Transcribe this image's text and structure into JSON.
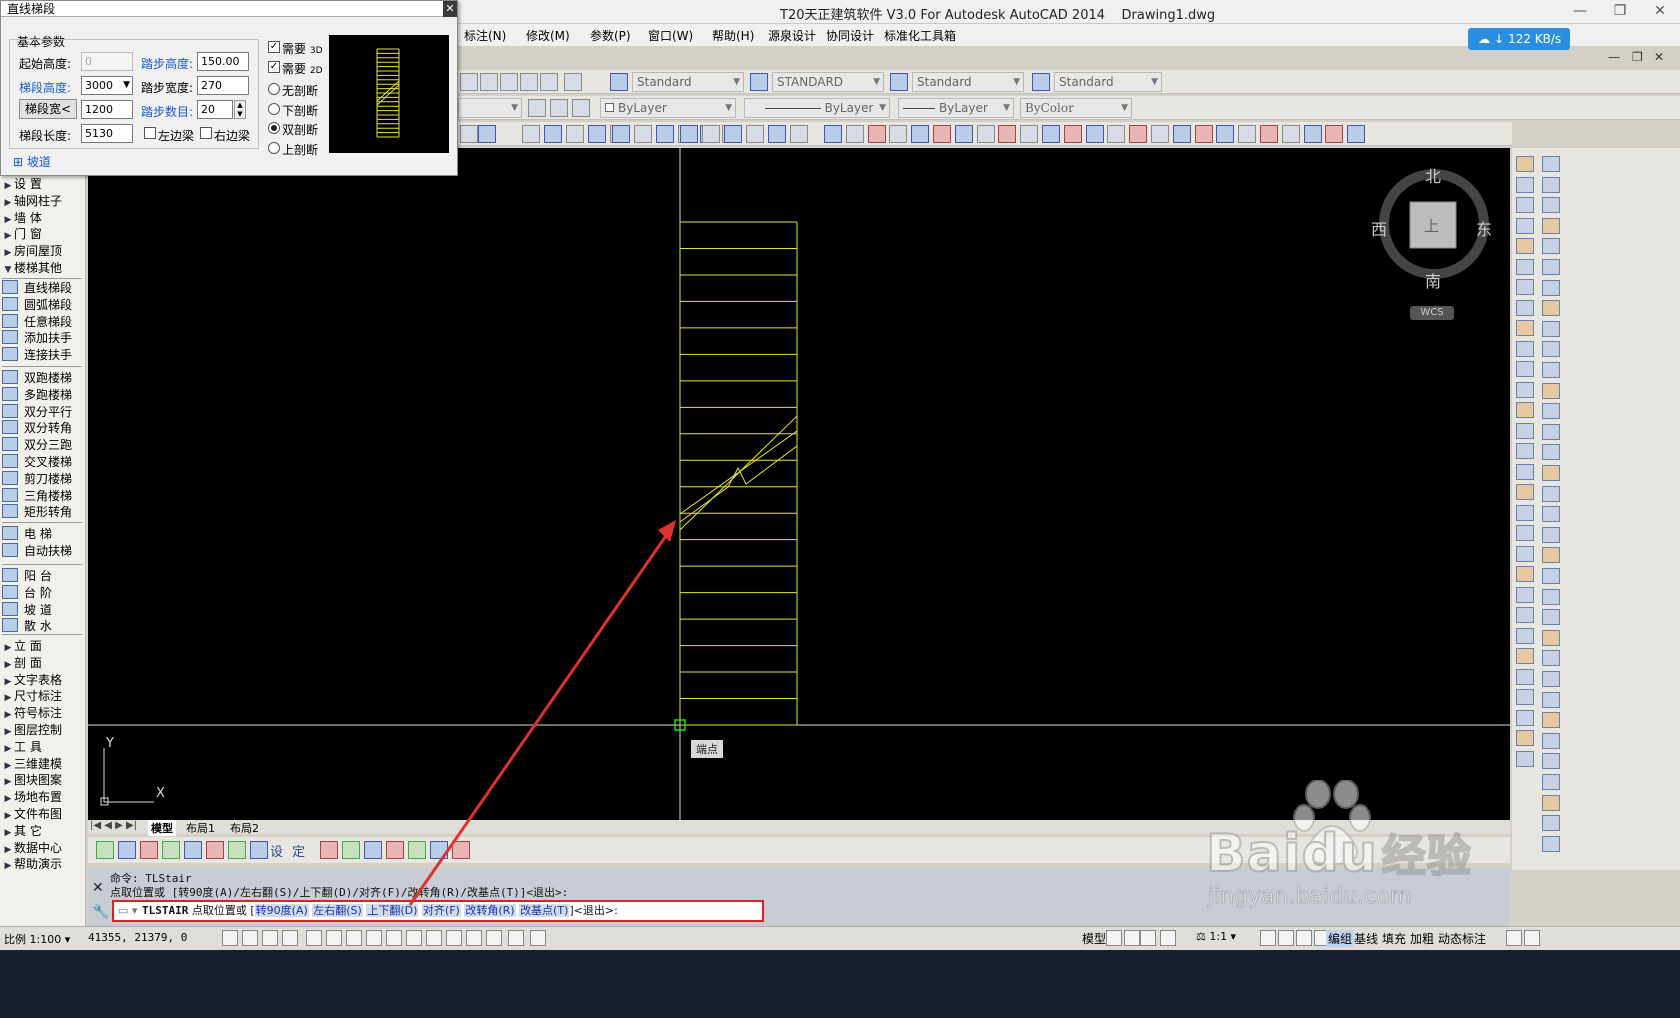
{
  "window": {
    "title": "T20天正建筑软件 V3.0 For Autodesk AutoCAD 2014    Drawing1.dwg",
    "min": "—",
    "restore": "❐",
    "close": "✕"
  },
  "menubar": {
    "items": [
      "标注(N)",
      "修改(M)",
      "参数(P)",
      "窗口(W)",
      "帮助(H)",
      "源泉设计",
      "协同设计",
      "标准化工具箱"
    ]
  },
  "speed_badge": "122 KB/s",
  "mdi_controls": [
    "—",
    "❐",
    "✕"
  ],
  "toolbar": {
    "styles": [
      "Standard",
      "STANDARD",
      "Standard",
      "Standard"
    ],
    "layers": [
      "ByLayer",
      "ByLayer",
      "ByLayer",
      "ByColor"
    ]
  },
  "dialog": {
    "title": "直线梯段",
    "group_title": "基本参数",
    "start_height_label": "起始高度:",
    "start_height_value": "0",
    "step_height_label": "踏步高度:",
    "step_height_value": "150.00",
    "flight_height_label": "梯段高度:",
    "flight_height_value": "3000",
    "step_width_label": "踏步宽度:",
    "step_width_value": "270",
    "flight_width_button": "梯段宽<",
    "flight_width_value": "1200",
    "step_count_label": "踏步数目:",
    "step_count_value": "20",
    "flight_length_label": "梯段长度:",
    "flight_length_value": "5130",
    "left_beam_label": "左边梁",
    "right_beam_label": "右边梁",
    "need3d_label": "需要",
    "need3d_tag": "3D",
    "need2d_label": "需要",
    "need2d_tag": "2D",
    "radio_none": "无剖断",
    "radio_lower": "下剖断",
    "radio_double": "双剖断",
    "radio_upper": "上剖断",
    "ramp_label": "坡道",
    "ramp_prefix": "⊞"
  },
  "left_panel": {
    "group1": [
      {
        "label": "设    置"
      },
      {
        "label": "轴网柱子"
      },
      {
        "label": "墙    体"
      },
      {
        "label": "门    窗"
      },
      {
        "label": "房间屋顶"
      },
      {
        "label": "楼梯其他"
      }
    ],
    "group2": [
      {
        "label": "直线梯段"
      },
      {
        "label": "圆弧梯段"
      },
      {
        "label": "任意梯段"
      },
      {
        "label": "添加扶手"
      },
      {
        "label": "连接扶手"
      }
    ],
    "group3": [
      {
        "label": "双跑楼梯"
      },
      {
        "label": "多跑楼梯"
      },
      {
        "label": "双分平行"
      },
      {
        "label": "双分转角"
      },
      {
        "label": "双分三跑"
      },
      {
        "label": "交叉楼梯"
      },
      {
        "label": "剪刀楼梯"
      },
      {
        "label": "三角楼梯"
      },
      {
        "label": "矩形转角"
      }
    ],
    "group4": [
      {
        "label": "电    梯"
      },
      {
        "label": "自动扶梯"
      }
    ],
    "group5": [
      {
        "label": "阳    台"
      },
      {
        "label": "台    阶"
      },
      {
        "label": "坡    道"
      },
      {
        "label": "散    水"
      }
    ],
    "group6": [
      {
        "label": "立    面"
      },
      {
        "label": "剖    面"
      },
      {
        "label": "文字表格"
      },
      {
        "label": "尺寸标注"
      },
      {
        "label": "符号标注"
      },
      {
        "label": "图层控制"
      },
      {
        "label": "工    具"
      },
      {
        "label": "三维建模"
      },
      {
        "label": "图块图案"
      },
      {
        "label": "场地布置"
      },
      {
        "label": "文件布图"
      },
      {
        "label": "其    它"
      },
      {
        "label": "数据中心"
      },
      {
        "label": "帮助演示"
      }
    ]
  },
  "compass": {
    "north": "北",
    "south": "南",
    "east": "东",
    "west": "西",
    "top": "上",
    "wcs": "WCS"
  },
  "drawing": {
    "osnap_tooltip": "端点",
    "ucs_x": "X",
    "ucs_y": "Y"
  },
  "layout_tabs": [
    "模型",
    "布局1",
    "布局2"
  ],
  "bottom_toolbar": {
    "set_label": "设",
    "fix_label": "定"
  },
  "command": {
    "history1": "命令: TLStair",
    "history2": "点取位置或 [转90度(A)/左右翻(S)/上下翻(D)/对齐(F)/改转角(R)/改基点(T)]<退出>:",
    "prefix": "TLSTAIR",
    "prompt": "点取位置或 [",
    "options": [
      "转90度(A)",
      "左右翻(S)",
      "上下翻(D)",
      "对齐(F)",
      "改转角(R)",
      "改基点(T)"
    ],
    "suffix": "]<退出>:"
  },
  "status": {
    "scale": "比例 1:100 ▾",
    "coords": "41355, 21379, 0",
    "model": "模型",
    "anno_scale": "1:1 ▾",
    "right_buttons": [
      "编组",
      "基线",
      "填充",
      "加粗",
      "动态标注"
    ]
  },
  "watermark": {
    "brand": "Baidu",
    "sub": "经验",
    "url": "jingyan.baidu.com"
  },
  "colors": {
    "stair_line": "#e6e632",
    "arrow": "#e03030",
    "drawing_bg": "#000000",
    "accent_blue": "#1a5ad0"
  }
}
